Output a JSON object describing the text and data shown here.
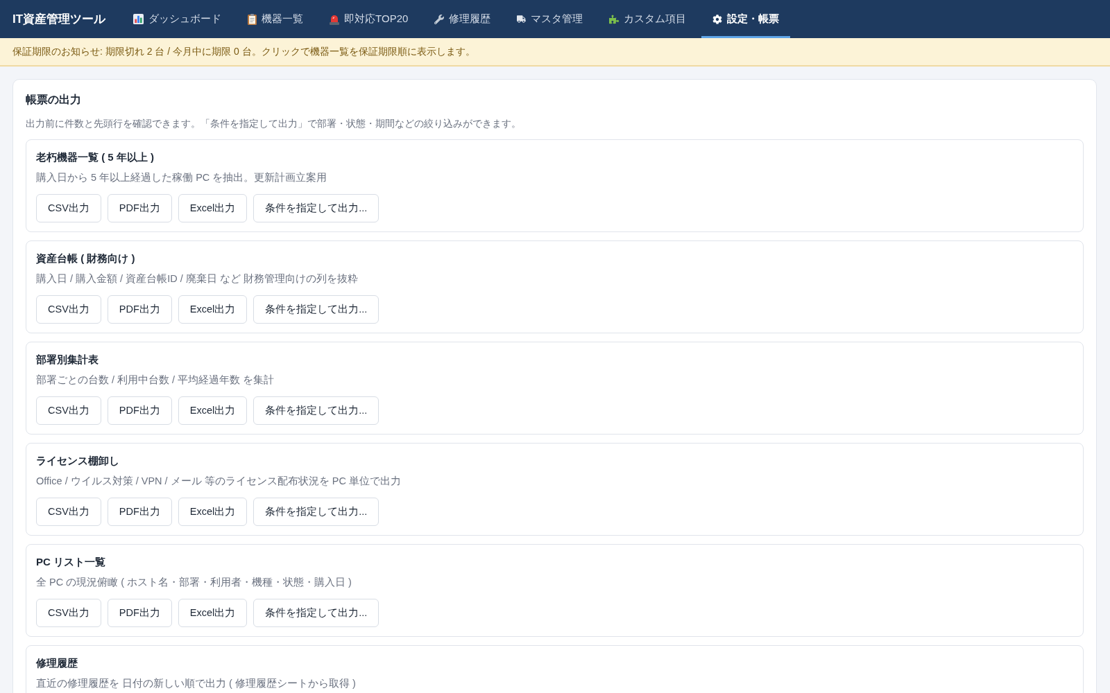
{
  "app_title": "IT資産管理ツール",
  "nav": {
    "tabs": [
      {
        "label": "ダッシュボード",
        "selected": false
      },
      {
        "label": "機器一覧",
        "selected": false
      },
      {
        "label": "即対応TOP20",
        "selected": false
      },
      {
        "label": "修理履歴",
        "selected": false
      },
      {
        "label": "マスタ管理",
        "selected": false
      },
      {
        "label": "カスタム項目",
        "selected": false
      },
      {
        "label": "設定・帳票",
        "selected": true
      }
    ]
  },
  "notice": {
    "text": "保証期限のお知らせ: 期限切れ 2 台 / 今月中に期限 0 台。クリックで機器一覧を保証期限順に表示します。"
  },
  "report_section": {
    "title": "帳票の出力",
    "description": "出力前に件数と先頭行を確認できます。「条件を指定して出力」で部署・状態・期間などの絞り込みができます。",
    "reports": [
      {
        "title": "老朽機器一覧 ( 5 年以上 )",
        "description": "購入日から 5 年以上経過した稼働 PC を抽出。更新計画立案用",
        "buttons": [
          "CSV出力",
          "PDF出力",
          "Excel出力",
          "条件を指定して出力..."
        ]
      },
      {
        "title": "資産台帳 ( 財務向け )",
        "description": "購入日 / 購入金額 / 資産台帳ID / 廃棄日 など 財務管理向けの列を抜粋",
        "buttons": [
          "CSV出力",
          "PDF出力",
          "Excel出力",
          "条件を指定して出力..."
        ]
      },
      {
        "title": "部署別集計表",
        "description": "部署ごとの台数 / 利用中台数 / 平均経過年数 を集計",
        "buttons": [
          "CSV出力",
          "PDF出力",
          "Excel出力",
          "条件を指定して出力..."
        ]
      },
      {
        "title": "ライセンス棚卸し",
        "description": "Office / ウイルス対策 / VPN / メール 等のライセンス配布状況を PC 単位で出力",
        "buttons": [
          "CSV出力",
          "PDF出力",
          "Excel出力",
          "条件を指定して出力..."
        ]
      },
      {
        "title": "PC リスト一覧",
        "description": "全 PC の現況俯瞰 ( ホスト名・部署・利用者・機種・状態・購入日 )",
        "buttons": [
          "CSV出力",
          "PDF出力",
          "Excel出力",
          "条件を指定して出力..."
        ]
      },
      {
        "title": "修理履歴",
        "description": "直近の修理履歴を 日付の新しい順で出力 ( 修理履歴シートから取得 )"
      }
    ]
  }
}
